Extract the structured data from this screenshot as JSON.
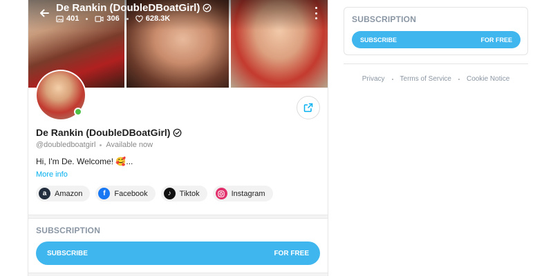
{
  "profile": {
    "display_name": "De Rankin (DoubleDBoatGirl)",
    "handle": "@doubledboatgirl",
    "availability": "Available now",
    "bio": "Hi, I'm De. Welcome! 🥰...",
    "more_info_label": "More info",
    "stats": {
      "photos": "401",
      "videos": "306",
      "likes": "628.3K"
    }
  },
  "socials": [
    {
      "label": "Amazon",
      "icon": "amazon-icon"
    },
    {
      "label": "Facebook",
      "icon": "facebook-icon"
    },
    {
      "label": "Tiktok",
      "icon": "tiktok-icon"
    },
    {
      "label": "Instagram",
      "icon": "instagram-icon"
    }
  ],
  "subscription": {
    "title": "SUBSCRIPTION",
    "button_label": "SUBSCRIBE",
    "price_label": "FOR FREE"
  },
  "sidebar": {
    "subscription_title": "SUBSCRIPTION",
    "button_label": "SUBSCRIBE",
    "price_label": "FOR FREE"
  },
  "footer": {
    "links": [
      "Privacy",
      "Terms of Service",
      "Cookie Notice"
    ]
  },
  "colors": {
    "accent": "#00aff0",
    "button": "#3fb6ee",
    "online": "#4dc247",
    "muted": "#8a96a3"
  }
}
